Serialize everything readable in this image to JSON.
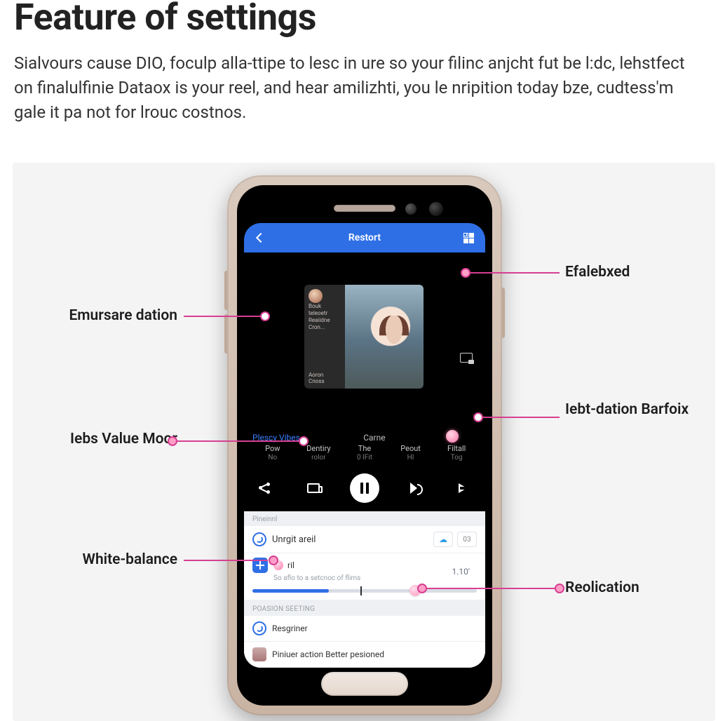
{
  "page": {
    "title": "Feature of settings",
    "description": "Sialvours cause DIO, foculp alla-ttipe to lesc in ure so your filinc anjcht fut be l:dc, lehstfect on finalulfinie Dataox is your reel, and hear amilizhti, you le nripition today bze, cudtess'm gale it pa not for lrouc costnos."
  },
  "header": {
    "title": "Restort"
  },
  "album": {
    "line1": "Bouk teleoetr",
    "line2": "Reaiidne Cron...",
    "bottom1": "Aoron",
    "bottom2": "Cnoss"
  },
  "tabs": {
    "left_label": "Plescy Vibes",
    "center_label": "Carne",
    "columns": [
      {
        "t1": "Pow",
        "t2": "No"
      },
      {
        "t1": "Dentiry",
        "t2": "rolor"
      },
      {
        "t1": "The",
        "t2": "0 IFit"
      },
      {
        "t1": "Peout",
        "t2": "HI"
      },
      {
        "t1": "Filtall",
        "t2": "Tog"
      }
    ]
  },
  "white_panel": {
    "caption": "Pineinnl",
    "row1_title": "Unrgit areil",
    "row1_badge": "03",
    "sub_title": "ril",
    "sub_desc": "So aflo to a setcnoc of flims",
    "sub_value": "1.10'",
    "section_title": "POASION SEETING",
    "row2_title": "Resgriner",
    "row3_title": "Piniuer action Better pesioned"
  },
  "annotations": {
    "left": [
      "Emursare dation",
      "Iebs Value Moor",
      "White-balance"
    ],
    "right": [
      "Efalebxed",
      "Iebt-dation Barfoix",
      "Reolication"
    ]
  }
}
